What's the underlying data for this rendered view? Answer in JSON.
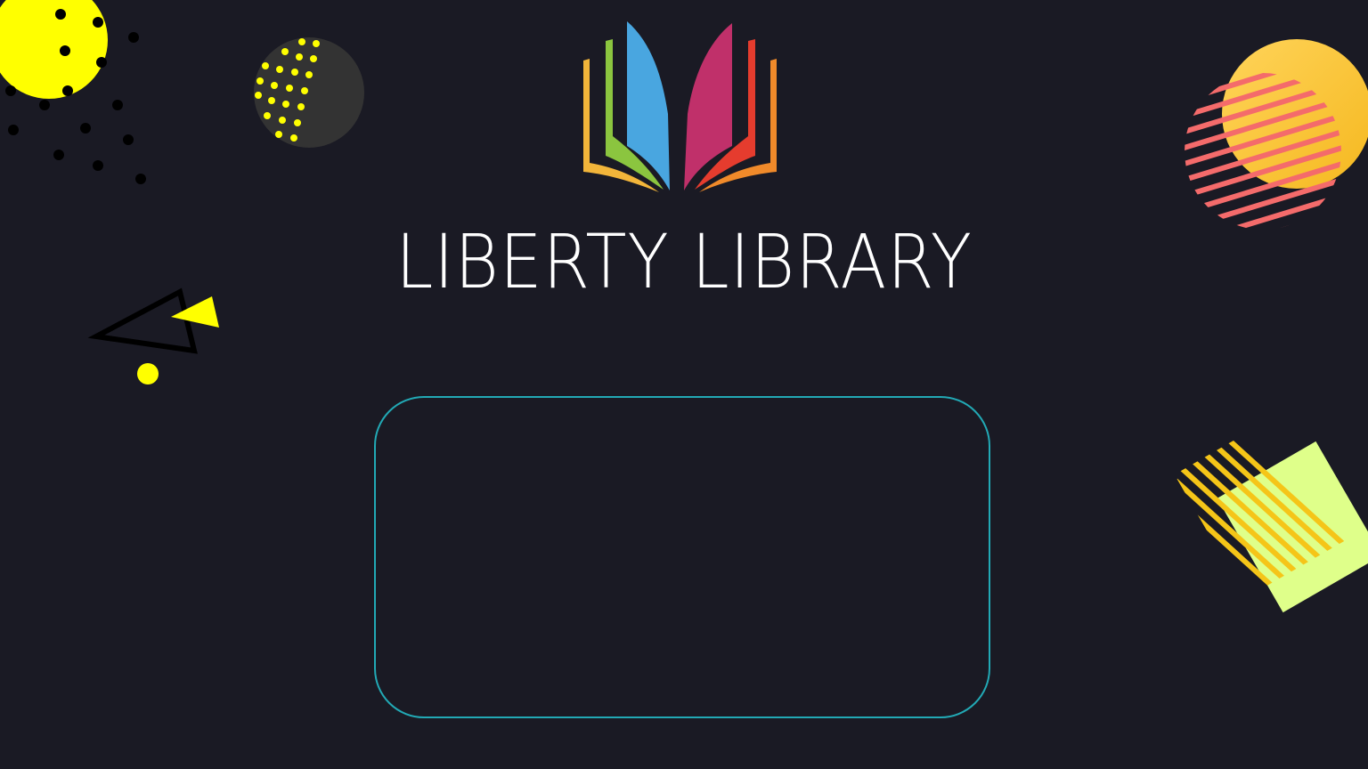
{
  "app": {
    "title": "LIBERTY LIBRARY"
  },
  "logo": {
    "icon": "open-book-icon",
    "colors": {
      "left_outer": "#f2b53a",
      "left_middle": "#8bc53f",
      "left_inner": "#49a6e0",
      "right_inner": "#c0306a",
      "right_middle": "#e53c2e",
      "right_outer": "#f08a2a"
    }
  },
  "theme": {
    "background": "#1a1a24",
    "accent": "#22a9b5",
    "title_color": "#ffffff"
  },
  "decorations": {
    "shapes": [
      "yellow-circle-icon",
      "dark-dotted-circle-icon",
      "triangle-icon",
      "striped-sun-icon",
      "striped-square-icon"
    ]
  }
}
